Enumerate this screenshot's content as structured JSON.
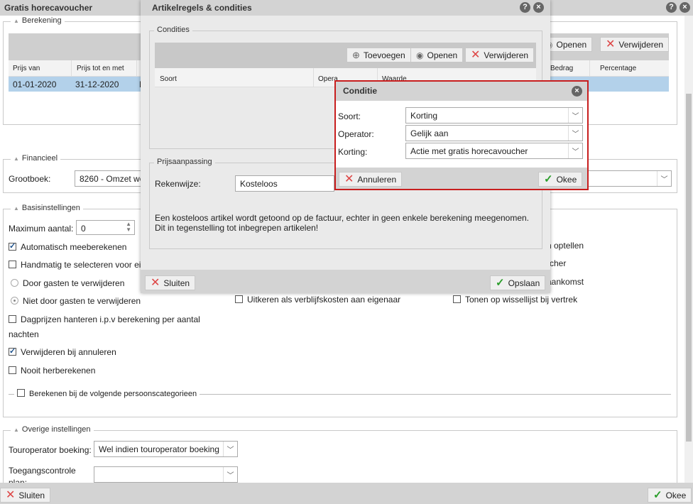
{
  "main": {
    "title": "Gratis horecavoucher",
    "berekening": {
      "legend": "Berekening",
      "open_label": "Openen",
      "delete_label": "Verwijderen",
      "columns": [
        "Prijs van",
        "Prijs tot en met",
        "Bedrag",
        "Percentage"
      ],
      "row": {
        "from": "01-01-2020",
        "to": "31-12-2020",
        "extra": "N"
      }
    },
    "financieel": {
      "legend": "Financieel",
      "grootboek_label": "Grootboek:",
      "grootboek_value": "8260 - Omzet we"
    },
    "basis": {
      "legend": "Basisinstellingen",
      "max_label": "Maximum aantal:",
      "max_value": "0",
      "auto": "Automatisch meeberekenen",
      "handmatig": "Handmatig te selecteren voor eig",
      "door_gasten": "Door gasten te verwijderen",
      "niet_door_gasten": "Niet door gasten te verwijderen",
      "dagprijzen_1": "Dagprijzen hanteren i.p.v berekening per aantal",
      "dagprijzen_2": "nachten",
      "verwijderen_annuleren": "Verwijderen bij annuleren",
      "nooit": "Nooit herberekenen",
      "uitkeren": "Uitkeren als verblijfskosten aan eigenaar",
      "tonen": "Tonen op wissellijst bij vertrek",
      "right_1": "n optellen",
      "right_2": "cher",
      "right_3": "aankomst",
      "persoons": "Berekenen bij de volgende persoonscategorieen"
    },
    "overige": {
      "legend": "Overige instellingen",
      "touroperator_label": "Touroperator boeking:",
      "touroperator_value": "Wel indien touroperator boeking",
      "toegang_label_1": "Toegangscontrole",
      "toegang_label_2": "plan:"
    },
    "close_label": "Sluiten",
    "ok_label": "Okee"
  },
  "artikel": {
    "title": "Artikelregels & condities",
    "condities_legend": "Condities",
    "add_label": "Toevoegen",
    "open_label": "Openen",
    "delete_label": "Verwijderen",
    "columns": [
      "Soort",
      "Opera",
      "Waarde"
    ],
    "prijs_legend": "Prijsaanpassing",
    "rekenwijze_label": "Rekenwijze:",
    "rekenwijze_value": "Kosteloos",
    "description": "Een kosteloos artikel wordt getoond op de factuur, echter in geen enkele berekening meegenomen. Dit in tegenstelling tot inbegrepen artikelen!",
    "close_label": "Sluiten",
    "save_label": "Opslaan"
  },
  "conditie": {
    "title": "Conditie",
    "soort_label": "Soort:",
    "soort_value": "Korting",
    "operator_label": "Operator:",
    "operator_value": "Gelijk aan",
    "korting_label": "Korting:",
    "korting_value": "Actie met gratis horecavoucher",
    "cancel_label": "Annuleren",
    "ok_label": "Okee"
  },
  "colors": {
    "highlight_row": "#b3d1ea",
    "dialog_border": "#c81e1e",
    "header_bg": "#d3d3d3"
  }
}
